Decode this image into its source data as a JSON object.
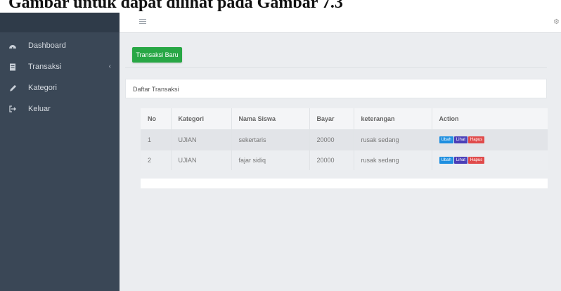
{
  "caption": {
    "text": "Gambar untuk dapat dilihat pada Gambar 7.3"
  },
  "colors": {
    "sidebar": "#3a4756",
    "primary_button": "#28a745",
    "edit_button": "#1f8fe0",
    "view_button": "#4b3fb8",
    "delete_button": "#e04b4b"
  },
  "sidebar": {
    "items": [
      {
        "label": "Dashboard",
        "icon": "dashboard-icon"
      },
      {
        "label": "Transaksi",
        "icon": "document-icon",
        "chevron": "‹"
      },
      {
        "label": "Kategori",
        "icon": "pencil-icon"
      },
      {
        "label": "Keluar",
        "icon": "logout-icon"
      }
    ]
  },
  "topbar": {
    "menu_icon": "hamburger-icon",
    "settings_glyph": "⚙"
  },
  "main": {
    "new_button": "Transaksi Baru",
    "card_title": "Daftar Transaksi",
    "table": {
      "headers": [
        "No",
        "Kategori",
        "Nama Siswa",
        "Bayar",
        "keterangan",
        "Action"
      ],
      "rows": [
        [
          "1",
          "UJIAN",
          "sekertaris",
          "20000",
          "rusak sedang"
        ],
        [
          "2",
          "UJIAN",
          "fajar sidiq",
          "20000",
          "rusak sedang"
        ]
      ],
      "actions": {
        "edit": "Ubah",
        "view": "Lihat",
        "delete": "Hapus"
      }
    }
  }
}
